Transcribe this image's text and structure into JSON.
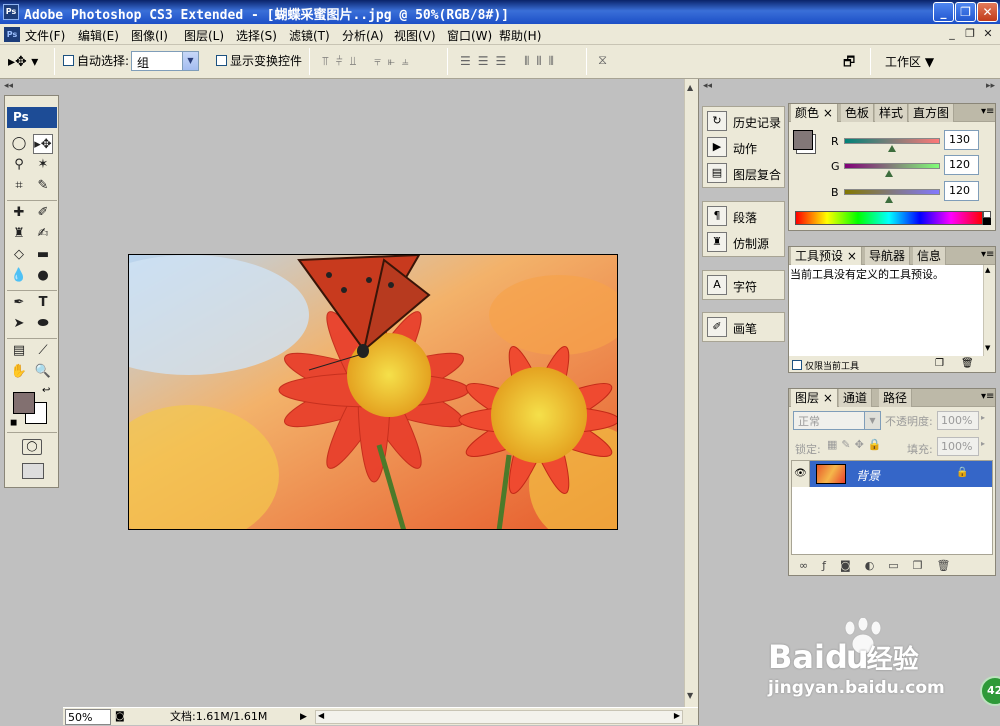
{
  "window": {
    "title": "Adobe Photoshop CS3 Extended - [蝴蝶采蜜图片..jpg @ 50%(RGB/8#)]",
    "app_icon": "Ps"
  },
  "menu": [
    {
      "label": "文件(F)"
    },
    {
      "label": "编辑(E)"
    },
    {
      "label": "图像(I)"
    },
    {
      "label": "图层(L)"
    },
    {
      "label": "选择(S)"
    },
    {
      "label": "滤镜(T)"
    },
    {
      "label": "分析(A)"
    },
    {
      "label": "视图(V)"
    },
    {
      "label": "窗口(W)"
    },
    {
      "label": "帮助(H)"
    }
  ],
  "options": {
    "auto_select_label": "自动选择:",
    "auto_select_value": "组",
    "show_transform_label": "显示变换控件",
    "workspace_label": "工作区 ▼"
  },
  "toolbox": {
    "header": "Ps",
    "foreground_color": "#827070",
    "background_color": "#ffffff"
  },
  "status": {
    "zoom": "50%",
    "doc_info": "文档:1.61M/1.61M"
  },
  "dock": {
    "items": [
      {
        "label": "历史记录",
        "icon": "history-icon"
      },
      {
        "label": "动作",
        "icon": "actions-icon"
      },
      {
        "label": "图层复合",
        "icon": "layer-comps-icon"
      },
      {
        "label": "段落",
        "icon": "paragraph-icon"
      },
      {
        "label": "仿制源",
        "icon": "clone-source-icon"
      },
      {
        "label": "字符",
        "icon": "character-icon"
      },
      {
        "label": "画笔",
        "icon": "brushes-icon"
      }
    ]
  },
  "color_panel": {
    "tabs": [
      "颜色",
      "色板",
      "样式",
      "直方图"
    ],
    "channels": [
      {
        "label": "R",
        "value": "130"
      },
      {
        "label": "G",
        "value": "120"
      },
      {
        "label": "B",
        "value": "120"
      }
    ],
    "fg_color": "#827878"
  },
  "tool_preset_panel": {
    "tabs": [
      "工具预设",
      "导航器",
      "信息"
    ],
    "message": "当前工具没有定义的工具预设。",
    "current_only_label": "仅限当前工具"
  },
  "layers_panel": {
    "tabs": [
      "图层",
      "通道",
      "路径"
    ],
    "blend_mode": "正常",
    "opacity_label": "不透明度:",
    "opacity_value": "100%",
    "lock_label": "锁定:",
    "fill_label": "填充:",
    "fill_value": "100%",
    "layers": [
      {
        "name": "背景",
        "selected": true
      }
    ]
  },
  "watermark": {
    "brand": "Bai",
    "brand_cn": "经验",
    "url": "jingyan.baidu.com",
    "badge": "42"
  }
}
